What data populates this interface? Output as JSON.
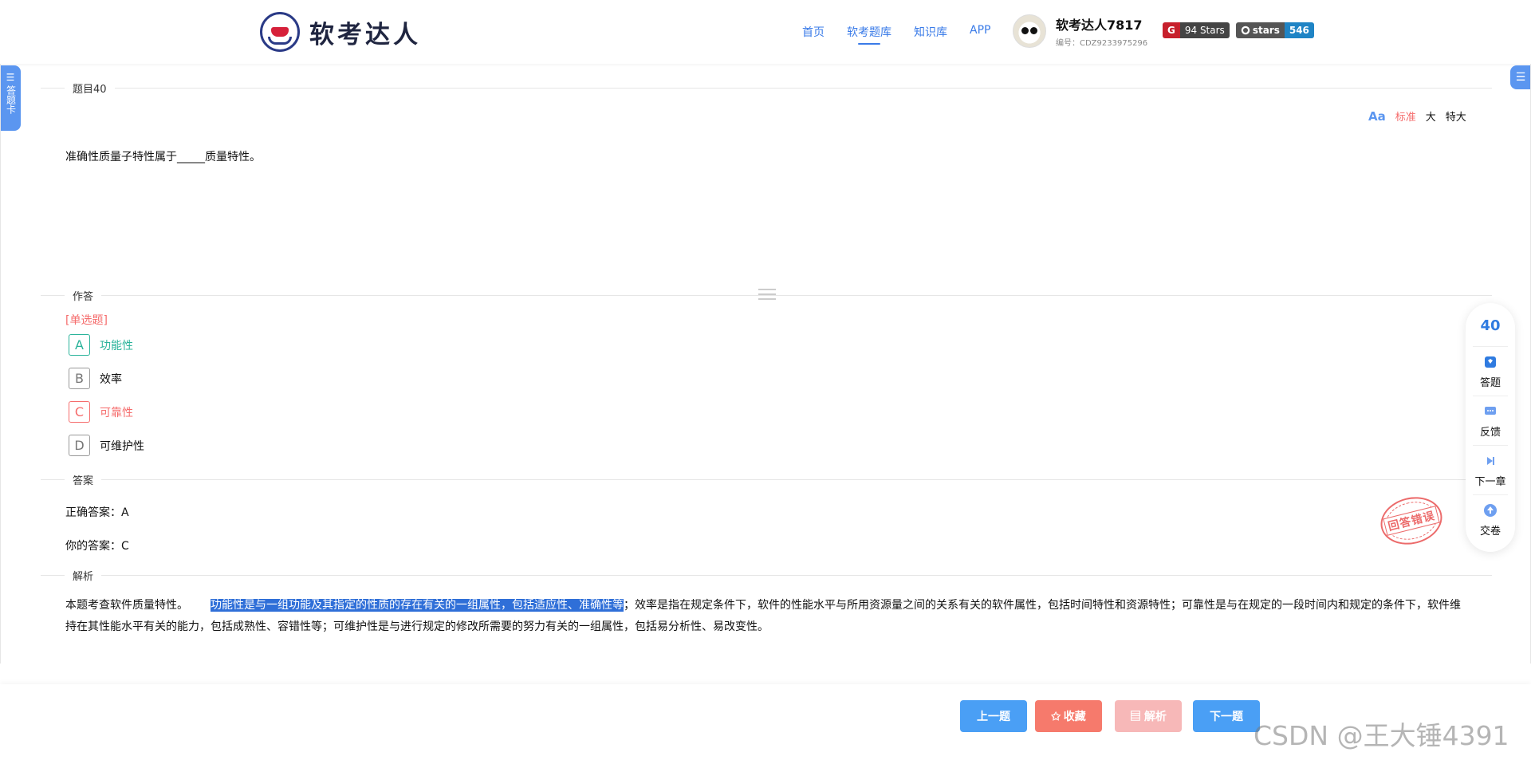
{
  "header": {
    "logo_text": "软考达人",
    "nav": [
      "首页",
      "软考题库",
      "知识库",
      "APP"
    ],
    "active_nav": "软考题库",
    "user_name": "软考达人7817",
    "user_id": "编号：CDZ9233975296",
    "badge1_left": "G",
    "badge1_right": "94 Stars",
    "badge2_left": "stars",
    "badge2_right": "546"
  },
  "side": {
    "answer_card": "答题卡"
  },
  "question": {
    "title": "题目40",
    "font_size_options": [
      "标准",
      "大",
      "特大"
    ],
    "font_size_selected": "标准",
    "text": "准确性质量子特性属于_____质量特性。"
  },
  "response": {
    "section_label": "作答",
    "type": "[单选题]",
    "options": [
      {
        "letter": "A",
        "text": "功能性",
        "state": "correct"
      },
      {
        "letter": "B",
        "text": "效率",
        "state": "normal"
      },
      {
        "letter": "C",
        "text": "可靠性",
        "state": "wrong"
      },
      {
        "letter": "D",
        "text": "可维护性",
        "state": "normal"
      }
    ]
  },
  "answer": {
    "section_label": "答案",
    "correct": "正确答案：A",
    "yours": "你的答案：C",
    "stamp": "回答错误"
  },
  "analysis": {
    "section_label": "解析",
    "intro": "本题考查软件质量特性。",
    "highlight": "功能性是与一组功能及其指定的性质的存在有关的一组属性，包括适应性、准确性等",
    "rest": "；效率是指在规定条件下，软件的性能水平与所用资源量之间的关系有关的软件属性，包括时间特性和资源特性；可靠性是与在规定的一段时间内和规定的条件下，软件维持在其性能水平有关的能力，包括成熟性、容错性等；可维护性是与进行规定的修改所需要的努力有关的一组属性，包括易分析性、易改变性。"
  },
  "float_bar": {
    "number": "40",
    "items": [
      "答题",
      "反馈",
      "下一章",
      "交卷"
    ]
  },
  "buttons": {
    "prev": "上一题",
    "fav": "✩ 收藏",
    "analysis": "▤ 解析",
    "next": "下一题"
  },
  "watermark": "CSDN @王大锤4391",
  "colors": {
    "accent": "#3a7be8",
    "correct": "#2ab39a",
    "wrong": "#f56c6c",
    "highlight": "#2f6fd8"
  }
}
